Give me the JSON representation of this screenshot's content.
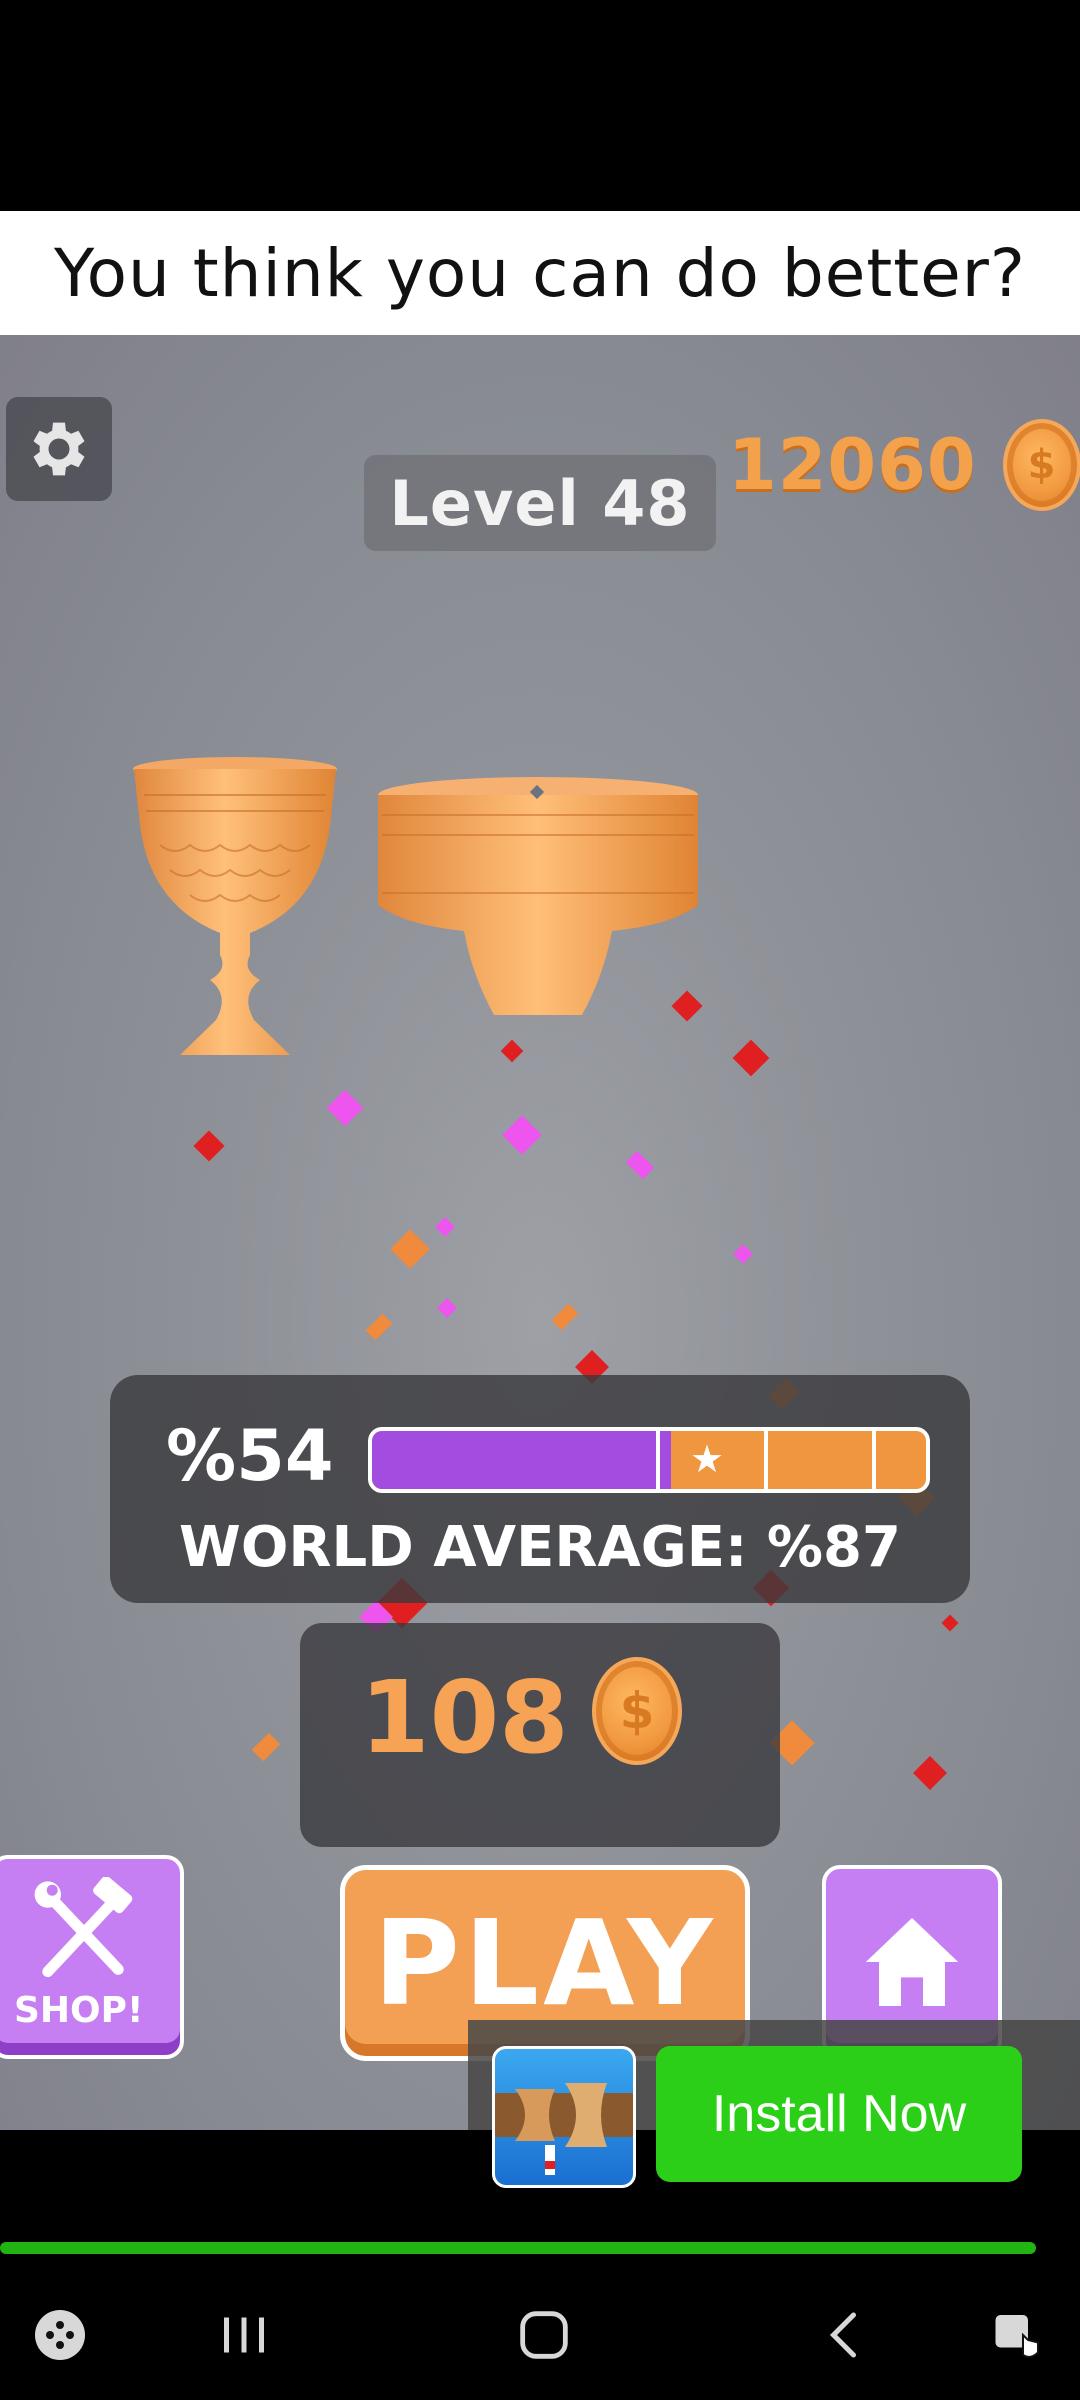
{
  "caption": {
    "text": "You think you can do better?"
  },
  "hud": {
    "level_label": "Level 48",
    "coin_total": "12060",
    "coin_symbol": "$"
  },
  "score": {
    "percent_label": "%54",
    "progress_fraction": 0.54,
    "world_average_label": "WORLD AVERAGE: %87"
  },
  "reward": {
    "amount": "108",
    "coin_symbol": "$"
  },
  "buttons": {
    "shop_label": "SHOP!",
    "play_label": "PLAY"
  },
  "ad": {
    "install_label": "Install Now"
  },
  "colors": {
    "accent_orange": "#f3a055",
    "accent_purple": "#a24de0",
    "install_green": "#2bcf18"
  },
  "icons": {
    "settings": "gear-icon",
    "shop": "hammer-wrench-icon",
    "home": "house-icon",
    "nav_game": "gamepad-icon",
    "nav_recents": "recent-apps-icon",
    "nav_home": "nav-home-icon",
    "nav_back": "back-icon",
    "nav_extra": "screen-touch-icon"
  }
}
